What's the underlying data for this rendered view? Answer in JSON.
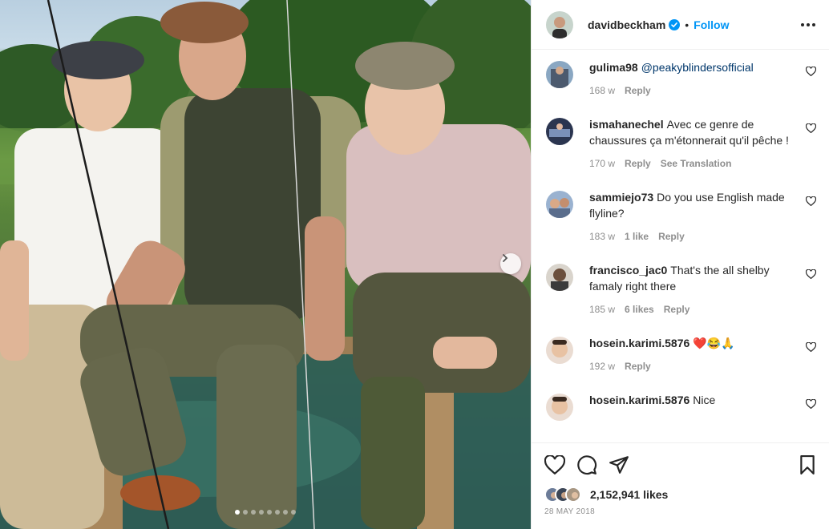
{
  "post": {
    "username": "davidbeckham",
    "follow_label": "Follow",
    "separator": "•",
    "image_count": 8,
    "active_index": 0
  },
  "comments": [
    {
      "user": "gulima98",
      "text": "@peakyblindersofficial",
      "time": "168 w",
      "likes": "",
      "reply": "Reply",
      "translate": ""
    },
    {
      "user": "ismahanechel",
      "text": "Avec ce genre de chaussures ça m'étonnerait qu'il pêche !",
      "time": "170 w",
      "likes": "",
      "reply": "Reply",
      "translate": "See Translation"
    },
    {
      "user": "sammiejo73",
      "text": "Do you use English made flyline?",
      "time": "183 w",
      "likes": "1 like",
      "reply": "Reply",
      "translate": ""
    },
    {
      "user": "francisco_jac0",
      "text": "That's the all shelby famaly right there",
      "time": "185 w",
      "likes": "6 likes",
      "reply": "Reply",
      "translate": ""
    },
    {
      "user": "hosein.karimi.5876",
      "text": "❤️😂🙏",
      "time": "192 w",
      "likes": "",
      "reply": "Reply",
      "translate": ""
    },
    {
      "user": "hosein.karimi.5876",
      "text": "Nice",
      "time": "",
      "likes": "",
      "reply": "",
      "translate": ""
    }
  ],
  "stats": {
    "likes": "2,152,941 likes",
    "date": "28 MAY 2018"
  },
  "icons": {
    "like": "heart-icon",
    "comment": "comment-icon",
    "share": "send-icon",
    "save": "bookmark-icon",
    "more": "more-icon",
    "next": "chevron-right-icon",
    "verified": "verified-badge-icon"
  },
  "colors": {
    "accent": "#0095f6",
    "verified": "#0095f6",
    "text": "#262626",
    "muted": "#8e8e8e"
  }
}
